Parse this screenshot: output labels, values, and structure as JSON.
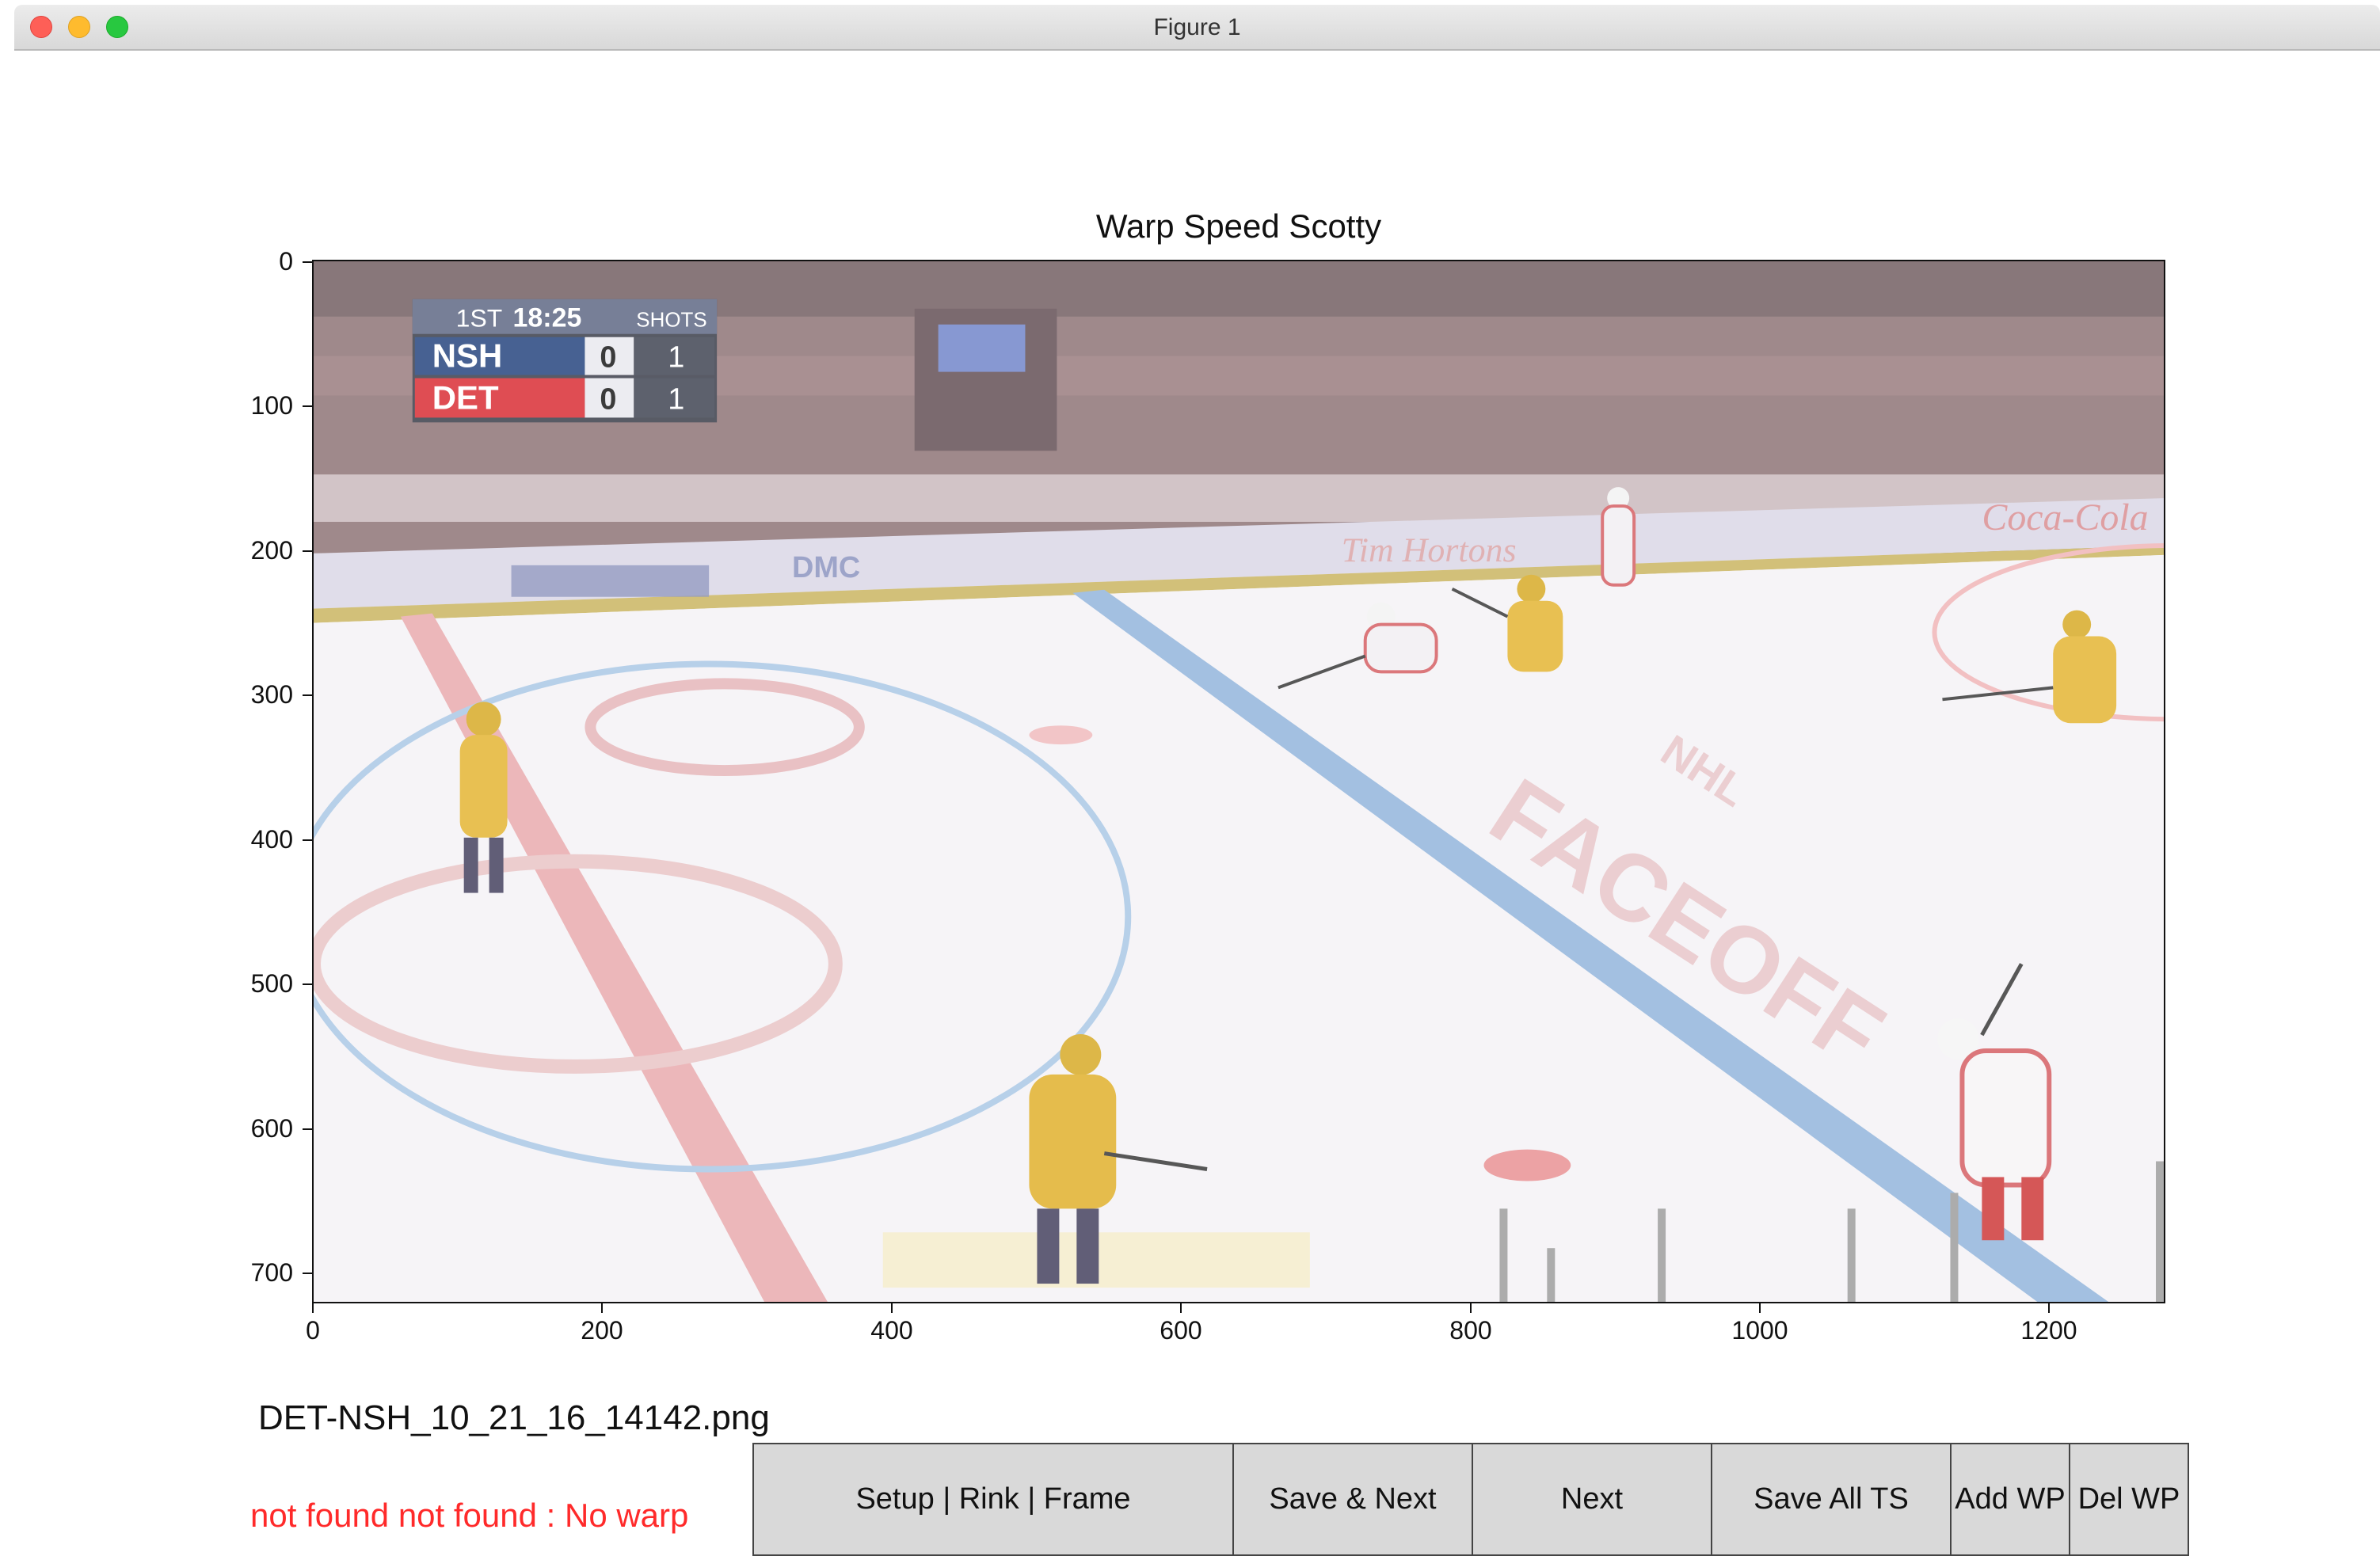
{
  "window": {
    "title": "Figure 1"
  },
  "plot": {
    "title": "Warp Speed Scotty",
    "y_ticks": [
      "0",
      "100",
      "200",
      "300",
      "400",
      "500",
      "600",
      "700"
    ],
    "x_ticks": [
      "0",
      "200",
      "400",
      "600",
      "800",
      "1000",
      "1200"
    ]
  },
  "scoreboard": {
    "period": "1ST",
    "clock": "18:25",
    "shots_label": "SHOTS",
    "teams": [
      {
        "abbr": "NSH",
        "score": "0",
        "shots": "1",
        "color": "#1f3f7a"
      },
      {
        "abbr": "DET",
        "score": "0",
        "shots": "1",
        "color": "#d8262e"
      }
    ]
  },
  "rink_text": {
    "faceoff": "FACEOFF",
    "nhl": "NHL",
    "cocacola": "Coca-Cola",
    "timhortons": "Tim Hortons",
    "dmc": "DMC"
  },
  "status": {
    "filename": "DET-NSH_10_21_16_14142.png",
    "message": "not found not found : No warp"
  },
  "buttons": [
    {
      "name": "setup-rink-frame-button",
      "label": "Setup | Rink | Frame"
    },
    {
      "name": "save-next-button",
      "label": "Save & Next"
    },
    {
      "name": "next-button",
      "label": "Next"
    },
    {
      "name": "save-all-ts-button",
      "label": "Save All TS"
    },
    {
      "name": "add-wp-button",
      "label": "Add WP"
    },
    {
      "name": "del-wp-button",
      "label": "Del WP"
    }
  ]
}
